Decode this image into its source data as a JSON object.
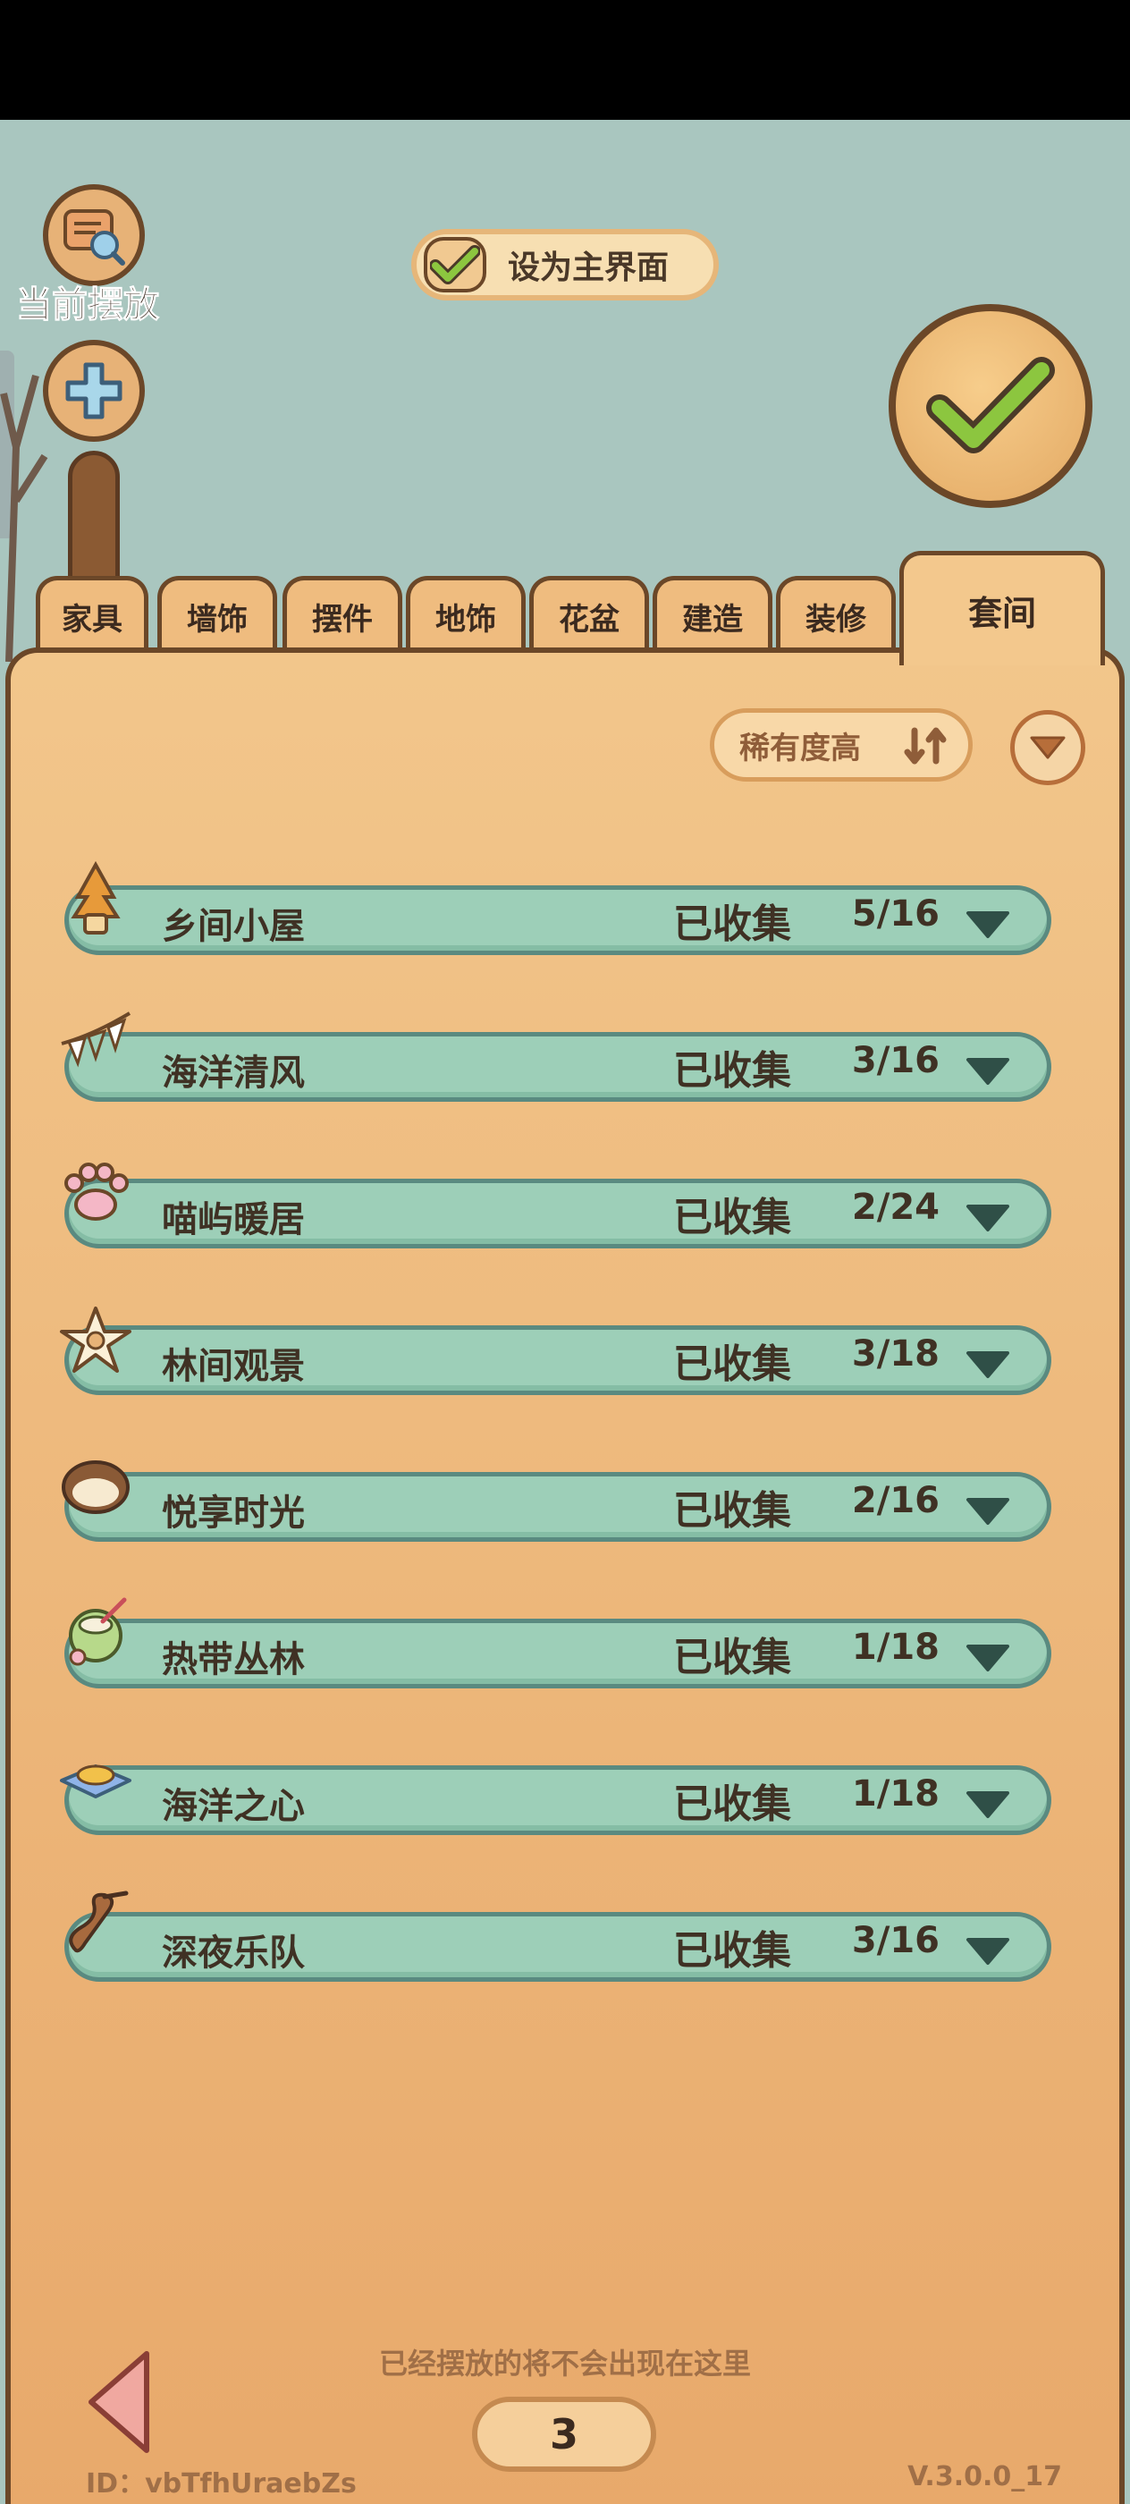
{
  "top": {
    "current_placement_label": "当前摆放",
    "set_main_label": "设为主界面"
  },
  "tabs": [
    {
      "label": "家具"
    },
    {
      "label": "墙饰"
    },
    {
      "label": "摆件"
    },
    {
      "label": "地饰"
    },
    {
      "label": "花盆"
    },
    {
      "label": "建造"
    },
    {
      "label": "装修"
    },
    {
      "label": "套间",
      "active": true
    }
  ],
  "sort": {
    "label": "稀有度高"
  },
  "sets": [
    {
      "name": "乡间小屋",
      "status": "已收集",
      "count": "5/16",
      "icon": "tree-icon"
    },
    {
      "name": "海洋清风",
      "status": "已收集",
      "count": "3/16",
      "icon": "bunting-icon"
    },
    {
      "name": "喵屿暖居",
      "status": "已收集",
      "count": "2/24",
      "icon": "paw-icon"
    },
    {
      "name": "林间观景",
      "status": "已收集",
      "count": "3/18",
      "icon": "flower-icon"
    },
    {
      "name": "悦享时光",
      "status": "已收集",
      "count": "2/16",
      "icon": "bread-icon"
    },
    {
      "name": "热带丛林",
      "status": "已收集",
      "count": "1/18",
      "icon": "coconut-icon"
    },
    {
      "name": "海洋之心",
      "status": "已收集",
      "count": "1/18",
      "icon": "dish-icon"
    },
    {
      "name": "深夜乐队",
      "status": "已收集",
      "count": "3/16",
      "icon": "music-icon"
    }
  ],
  "footer": {
    "notice": "已经摆放的将不会出现在这里",
    "page": "3",
    "uid": "ID：vbTfhUraebZs",
    "version": "V.3.0.0_17"
  },
  "colors": {
    "panel": "#f2c68b",
    "row": "#9dcfb8",
    "row_border": "#5a8a80",
    "outline": "#6b4728",
    "check_green": "#8cc63f"
  }
}
